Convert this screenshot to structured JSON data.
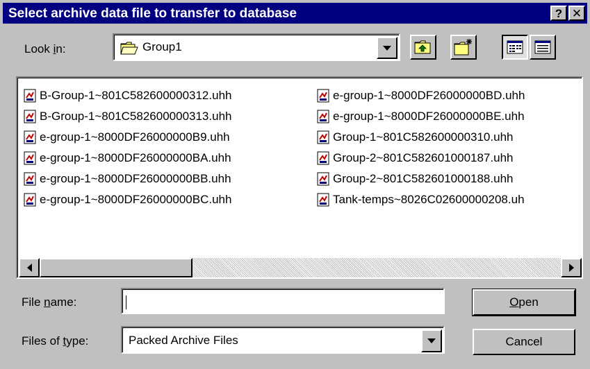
{
  "window": {
    "title": "Select archive data file to transfer to database",
    "help_glyph": "?",
    "close_glyph": "✕"
  },
  "lookin": {
    "label_pre": "Look ",
    "label_key": "i",
    "label_post": "n:",
    "folder": "Group1"
  },
  "files": {
    "col1": [
      "B-Group-1~801C582600000312.uhh",
      "B-Group-1~801C582600000313.uhh",
      "e-group-1~8000DF26000000B9.uhh",
      "e-group-1~8000DF26000000BA.uhh",
      "e-group-1~8000DF26000000BB.uhh",
      "e-group-1~8000DF26000000BC.uhh"
    ],
    "col2": [
      "e-group-1~8000DF26000000BD.uhh",
      "e-group-1~8000DF26000000BE.uhh",
      "Group-1~801C582600000310.uhh",
      "Group-2~801C582601000187.uhh",
      "Group-2~801C582601000188.uhh",
      "Tank-temps~8026C02600000208.uh"
    ]
  },
  "filename": {
    "label_pre": "File ",
    "label_key": "n",
    "label_post": "ame:",
    "value": ""
  },
  "filetype": {
    "label_pre": "Files of ",
    "label_key": "t",
    "label_post": "ype:",
    "value": "Packed Archive Files"
  },
  "buttons": {
    "open_key": "O",
    "open_rest": "pen",
    "cancel": "Cancel"
  },
  "colors": {
    "titlebar": "#000080",
    "face": "#c0c0c0"
  }
}
